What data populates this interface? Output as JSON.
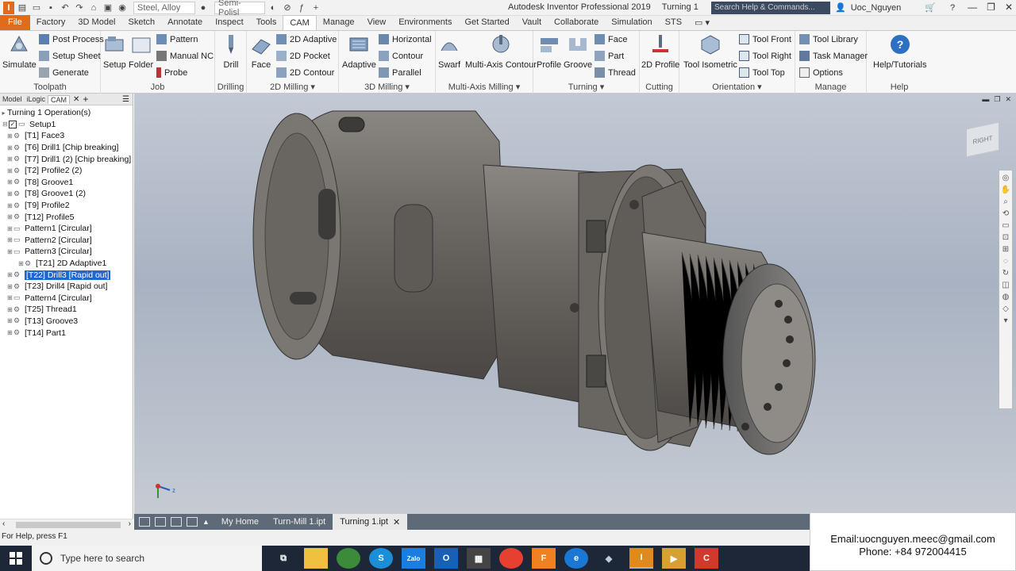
{
  "title_bar": {
    "material": "Steel, Alloy",
    "appearance": "Semi-Polisl",
    "app_title": "Autodesk Inventor Professional 2019",
    "document_title": "Turning 1",
    "search_placeholder": "Search Help & Commands...",
    "user": "Uoc_Nguyen"
  },
  "ribbon_tabs": [
    "File",
    "Factory",
    "3D Model",
    "Sketch",
    "Annotate",
    "Inspect",
    "Tools",
    "CAM",
    "Manage",
    "View",
    "Environments",
    "Get Started",
    "Vault",
    "Collaborate",
    "Simulation",
    "STS"
  ],
  "active_tab": "CAM",
  "ribbon": {
    "toolpath": {
      "label": "Toolpath",
      "simulate": "Simulate",
      "post_process": "Post Process",
      "setup_sheet": "Setup Sheet",
      "generate": "Generate"
    },
    "job": {
      "label": "Job",
      "setup": "Setup",
      "folder": "Folder",
      "pattern": "Pattern",
      "manual_nc": "Manual NC",
      "probe": "Probe"
    },
    "drilling": {
      "label": "Drilling",
      "drill": "Drill"
    },
    "milling2d": {
      "label": "2D Milling",
      "face": "Face",
      "adaptive": "2D Adaptive",
      "pocket": "2D Pocket",
      "contour": "2D Contour"
    },
    "milling3d": {
      "label": "3D Milling",
      "adaptive": "Adaptive",
      "horizontal": "Horizontal",
      "contour": "Contour",
      "parallel": "Parallel"
    },
    "multiaxis": {
      "label": "Multi-Axis Milling",
      "swarf": "Swarf",
      "multi_axis_contour": "Multi-Axis Contour"
    },
    "turning": {
      "label": "Turning",
      "profile": "Profile",
      "groove": "Groove",
      "face": "Face",
      "part": "Part",
      "thread": "Thread"
    },
    "cutting": {
      "label": "Cutting",
      "profile_2d": "2D Profile"
    },
    "orientation": {
      "label": "Orientation",
      "tool_isometric": "Tool Isometric",
      "tool_front": "Tool Front",
      "tool_right": "Tool Right",
      "tool_top": "Tool Top"
    },
    "manage": {
      "label": "Manage",
      "tool_library": "Tool Library",
      "task_manager": "Task Manager",
      "options": "Options"
    },
    "help": {
      "label": "Help",
      "help_tutorials": "Help/Tutorials"
    }
  },
  "browser": {
    "tabs": [
      "Model",
      "iLogic",
      "CAM"
    ],
    "root": "Turning 1 Operation(s)",
    "setup": "Setup1",
    "items": [
      "[T1] Face3",
      "[T6] Drill1 [Chip breaking]",
      "[T7] Drill1 (2) [Chip breaking]",
      "[T2] Profile2 (2)",
      "[T8] Groove1",
      "[T8] Groove1 (2)",
      "[T9] Profile2",
      "[T12] Profile5",
      "Pattern1 [Circular]",
      "Pattern2 [Circular]",
      "Pattern3 [Circular]",
      "[T21] 2D Adaptive1",
      "[T22] Drill3 [Rapid out]",
      "[T23] Drill4 [Rapid out]",
      "Pattern4 [Circular]",
      "[T25] Thread1",
      "[T13] Groove3",
      "[T14] Part1"
    ],
    "selected_index": 12
  },
  "viewcube_label": "RIGHT",
  "doc_tabs": [
    "My Home",
    "Turn-Mill 1.ipt",
    "Turning 1.ipt"
  ],
  "active_doc": "Turning 1.ipt",
  "status": "For Help, press F1",
  "contact": {
    "email": "Email:uocnguyen.meec@gmail.com",
    "phone": "Phone: +84 972004415"
  },
  "taskbar": {
    "search_placeholder": "Type here to search",
    "zalo": "Zalo"
  },
  "colors": {
    "file_tab": "#e06c1b",
    "selection": "#1e66d0",
    "taskbar": "#1d2738",
    "doc_tabs": "#5f6a78"
  }
}
